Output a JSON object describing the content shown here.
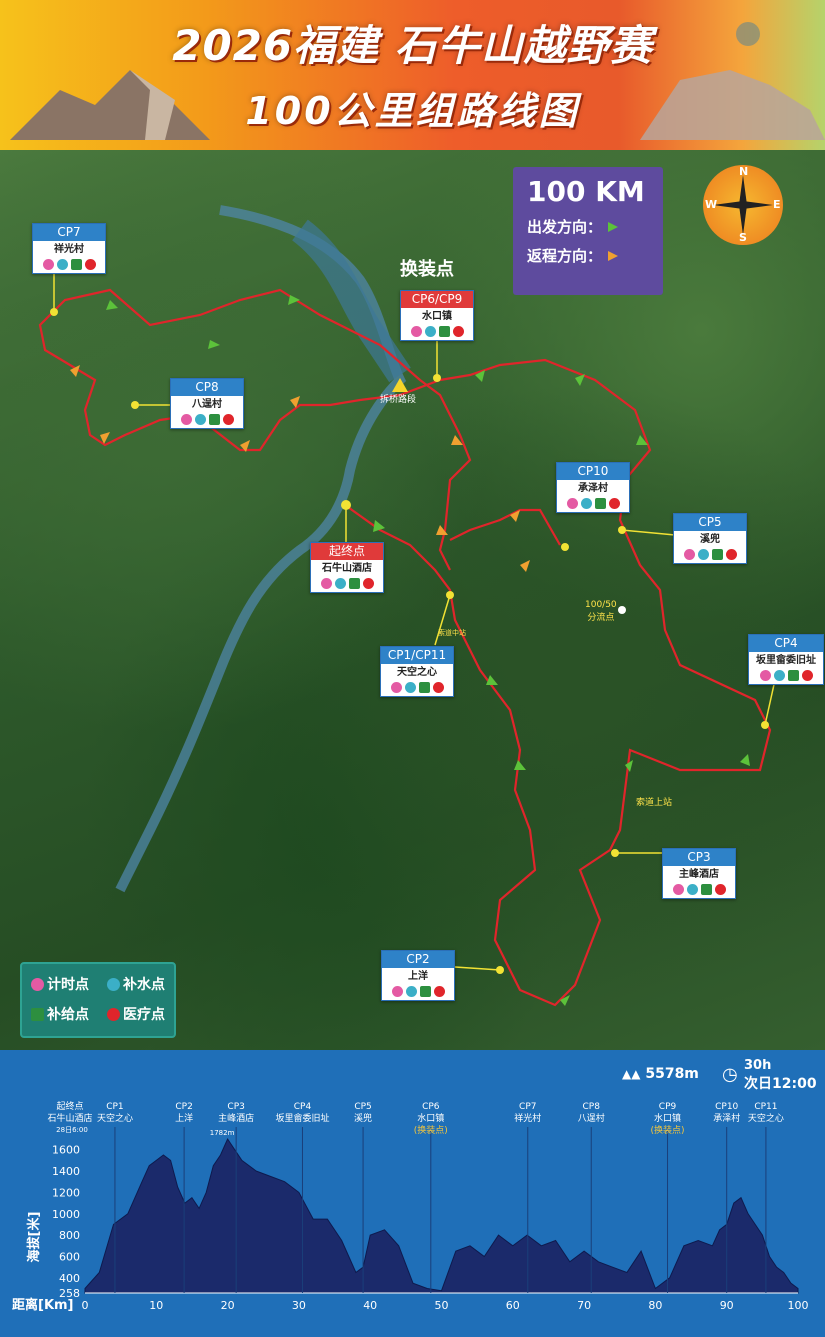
{
  "header": {
    "title_line1": "2026福建 石牛山越野赛",
    "title_line2": "100公里组路线图"
  },
  "direction_legend": {
    "distance": "100 KM",
    "outbound": "出发方向：",
    "return": "返程方向：",
    "outbound_color": "#5cc23a",
    "return_color": "#f0a030"
  },
  "compass": {
    "n": "N",
    "s": "S",
    "e": "E",
    "w": "W"
  },
  "map": {
    "change_point": "换装点",
    "bridge_label": "拆桥路段",
    "split_label": "100/50\n分流点",
    "cableway_label": "索道上站",
    "cableway_mid": "索道中站"
  },
  "checkpoints": [
    {
      "code": "CP7",
      "name": "祥光村"
    },
    {
      "code": "CP8",
      "name": "八逞村"
    },
    {
      "code": "CP6/CP9",
      "name": "水口镇"
    },
    {
      "code": "CP10",
      "name": "承泽村"
    },
    {
      "code": "CP5",
      "name": "溪兜"
    },
    {
      "code": "起终点",
      "name": "石牛山酒店"
    },
    {
      "code": "CP1/CP11",
      "name": "天空之心"
    },
    {
      "code": "CP4",
      "name": "坂里畲委旧址"
    },
    {
      "code": "CP3",
      "name": "主峰酒店"
    },
    {
      "code": "CP2",
      "name": "上洋"
    }
  ],
  "legend": {
    "timing": "计时点",
    "water": "补水点",
    "supply": "补给点",
    "medical": "医疗点"
  },
  "profile": {
    "elevation_gain": "5578m",
    "time_limit_1": "30h",
    "time_limit_2": "次日12:00",
    "y_axis_label": "海拔[米]",
    "x_axis_label": "距离[Km]",
    "start_label": "起终点",
    "start_name": "石牛山酒店",
    "start_time": "28日6:00",
    "peak_label": "1782m",
    "y_ticks": [
      "1600",
      "1400",
      "1200",
      "1000",
      "800",
      "600",
      "400",
      "258"
    ],
    "x_ticks": [
      "0",
      "10",
      "20",
      "30",
      "40",
      "50",
      "60",
      "70",
      "80",
      "90",
      "100"
    ],
    "markers": [
      {
        "code": "CP1",
        "name": "天空之心",
        "km": 4.2
      },
      {
        "code": "CP2",
        "name": "上洋",
        "km": 13.9
      },
      {
        "code": "CP3",
        "name": "主峰酒店",
        "km": 21.2
      },
      {
        "code": "CP4",
        "name": "坂里畲委旧址",
        "km": 30.5
      },
      {
        "code": "CP5",
        "name": "溪兜",
        "km": 39.0
      },
      {
        "code": "CP6",
        "name": "水口镇",
        "km": 48.5,
        "note": "(换装点)"
      },
      {
        "code": "CP7",
        "name": "祥光村",
        "km": 62.1
      },
      {
        "code": "CP8",
        "name": "八逞村",
        "km": 71.0
      },
      {
        "code": "CP9",
        "name": "水口镇",
        "km": 81.7,
        "note": "(换装点)"
      },
      {
        "code": "CP10",
        "name": "承泽村",
        "km": 90.0
      },
      {
        "code": "CP11",
        "name": "天空之心",
        "km": 95.5
      }
    ]
  },
  "chart_data": {
    "type": "area",
    "xlabel": "距离[Km]",
    "ylabel": "海拔[米]",
    "xlim": [
      0,
      100
    ],
    "ylim": [
      258,
      1782
    ],
    "x": [
      0,
      2,
      4,
      6,
      8,
      9,
      10,
      11,
      12,
      13,
      14,
      15,
      16,
      17,
      18,
      19,
      20,
      21,
      22,
      24,
      26,
      28,
      30,
      32,
      34,
      36,
      37,
      38,
      39,
      40,
      42,
      44,
      46,
      48,
      50,
      52,
      54,
      56,
      58,
      60,
      62,
      64,
      66,
      68,
      70,
      72,
      74,
      76,
      78,
      80,
      82,
      84,
      86,
      88,
      89,
      90,
      91,
      92,
      93,
      94,
      95,
      96,
      97,
      98,
      99,
      100
    ],
    "values": [
      300,
      450,
      900,
      1000,
      1300,
      1450,
      1500,
      1550,
      1500,
      1250,
      1100,
      1150,
      1050,
      1200,
      1450,
      1550,
      1700,
      1600,
      1500,
      1400,
      1350,
      1300,
      1200,
      950,
      950,
      750,
      600,
      450,
      500,
      800,
      850,
      700,
      350,
      300,
      280,
      650,
      700,
      600,
      800,
      700,
      800,
      700,
      750,
      550,
      650,
      550,
      500,
      450,
      650,
      300,
      400,
      700,
      750,
      700,
      850,
      900,
      1100,
      1150,
      1000,
      900,
      800,
      600,
      500,
      450,
      350,
      300
    ]
  }
}
